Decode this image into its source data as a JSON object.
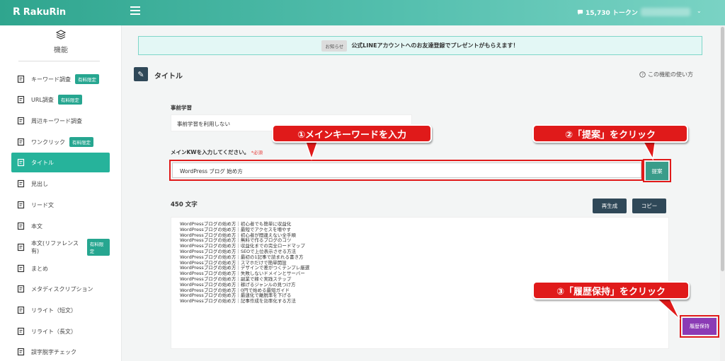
{
  "app": {
    "logo_mark": "R",
    "name": "RakuRin"
  },
  "topbar": {
    "tokens": "15,730 トークン"
  },
  "sidebar": {
    "title": "機能",
    "items": [
      {
        "label": "キーワード調査",
        "badge": "有料限定",
        "icon": "search-doc-icon"
      },
      {
        "label": "URL調査",
        "badge": "有料限定",
        "icon": "link-doc-icon"
      },
      {
        "label": "周辺キーワード調査",
        "badge": "",
        "icon": "search-doc-icon"
      },
      {
        "label": "ワンクリック",
        "badge": "有料限定",
        "icon": "target-icon"
      },
      {
        "label": "タイトル",
        "badge": "",
        "icon": "title-icon",
        "active": true
      },
      {
        "label": "見出し",
        "badge": "",
        "icon": "heading-icon"
      },
      {
        "label": "リード文",
        "badge": "",
        "icon": "lead-icon"
      },
      {
        "label": "本文",
        "badge": "",
        "icon": "body-icon"
      },
      {
        "label": "本文(リファレンス有)",
        "badge": "有料限定",
        "icon": "body-ref-icon"
      },
      {
        "label": "まとめ",
        "badge": "",
        "icon": "summary-icon"
      },
      {
        "label": "メタディスクリプション",
        "badge": "",
        "icon": "meta-icon"
      },
      {
        "label": "リライト（短文）",
        "badge": "",
        "icon": "pen-icon"
      },
      {
        "label": "リライト（長文）",
        "badge": "",
        "icon": "pen-sparkle-icon"
      },
      {
        "label": "誤字脱字チェック",
        "badge": "",
        "icon": "check-doc-icon"
      }
    ]
  },
  "notice": {
    "label": "お知らせ",
    "text": "公式LINEアカウントへのお友達登録でプレゼントがもらえます！"
  },
  "page": {
    "title": "タイトル",
    "help": "この機能の使い方"
  },
  "form": {
    "pretrain_label": "事前学習",
    "pretrain_value": "事前学習を利用しない",
    "kw_label": "メインKWを入力してください。",
    "required": "*必須",
    "kw_value": "WordPress ブログ 始め方",
    "suggest_button": "提案"
  },
  "result": {
    "char_count": "450 文字",
    "regenerate": "再生成",
    "copy": "コピー",
    "history": "履歴保持",
    "lines": [
      "WordPressブログの始め方｜初心者でも簡単に収益化",
      "WordPressブログの始め方｜最短でアクセスを増やす",
      "WordPressブログの始め方｜初心者が間違えない全手順",
      "WordPressブログの始め方｜無料で作るブログのコツ",
      "WordPressブログの始め方｜収益化までの完全ロードマップ",
      "WordPressブログの始め方｜SEOで上位表示させる方法",
      "WordPressブログの始め方｜最初の1記事で読まれる書き方",
      "WordPressブログの始め方｜スマホだけで簡単開設",
      "WordPressブログの始め方｜デザインで差がつくテンプレ厳選",
      "WordPressブログの始め方｜失敗しないドメインとサーバー",
      "WordPressブログの始め方｜副業で稼ぐ実践ステップ",
      "WordPressブログの始め方｜稼げるジャンルの見つけ方",
      "WordPressブログの始め方｜0円で始める最短ガイド",
      "WordPressブログの始め方｜最速化で離脱率を下げる",
      "WordPressブログの始め方｜記事作成を効率化する方法"
    ]
  },
  "annotations": {
    "step1": "①メインキーワードを入力",
    "step2": "②「提案」をクリック",
    "step3": "③「履歴保持」をクリック"
  },
  "colors": {
    "accent": "#26b39b",
    "callout": "#e01a1a",
    "history": "#8b3bb5",
    "dark": "#2f4858"
  }
}
